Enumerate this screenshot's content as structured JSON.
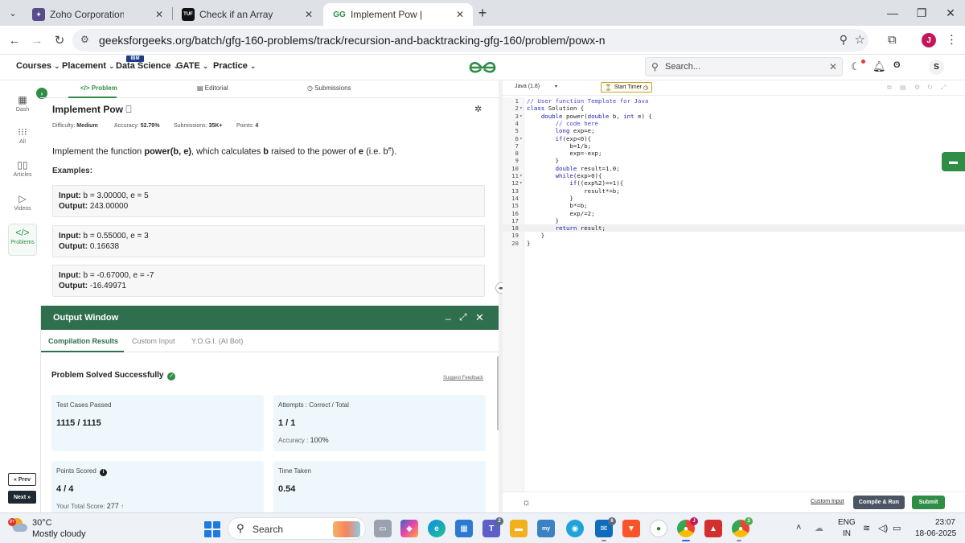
{
  "browser": {
    "tabs": [
      {
        "title": "Zoho Corporation | MTS | Chen",
        "active": false
      },
      {
        "title": "Check if an Array is Sorted - Tu",
        "active": false
      },
      {
        "title": "Implement Pow | Practice | Gee",
        "active": true
      }
    ],
    "url": "geeksforgeeks.org/batch/gfg-160-problems/track/recursion-and-backtracking-gfg-160/problem/powx-n",
    "profile_initial": "J"
  },
  "gfg_header": {
    "menu": [
      "Courses",
      "Placement",
      "Data Science",
      "GATE",
      "Practice"
    ],
    "ibm_badge": "IBM",
    "search_placeholder": "Search...",
    "user_initial": "S",
    "logo_color": "#2f8d46"
  },
  "rail": {
    "items": [
      "Dash",
      "All",
      "Articles",
      "Videos",
      "Problems"
    ],
    "active": "Problems",
    "prev_label": "« Prev",
    "next_label": "Next »"
  },
  "problem": {
    "tabs": [
      "Problem",
      "Editorial",
      "Submissions"
    ],
    "title": "Implement Pow",
    "meta": {
      "difficulty_label": "Difficulty:",
      "difficulty": "Medium",
      "accuracy_label": "Accuracy:",
      "accuracy": "52.79%",
      "submissions_label": "Submissions:",
      "submissions": "35K+",
      "points_label": "Points:",
      "points": "4"
    },
    "statement": {
      "prefix": "Implement the function ",
      "func": "power(b, e)",
      "mid": ", which calculates ",
      "b": "b",
      "mid2": " raised to the power of ",
      "e": "e",
      "suffix_open": " (i.e. b",
      "sup": "e",
      "suffix_close": ")."
    },
    "examples_label": "Examples:",
    "input_label": "Input:",
    "output_label": "Output:",
    "examples": [
      {
        "input": "b = 3.00000, e = 5",
        "output": "243.00000"
      },
      {
        "input": "b = 0.55000, e = 3",
        "output": "0.16638"
      },
      {
        "input": "b = -0.67000, e = -7",
        "output": "-16.49971"
      }
    ]
  },
  "output_window": {
    "title": "Output Window",
    "tabs": [
      "Compilation Results",
      "Custom Input",
      "Y.O.G.I. (AI Bot)"
    ],
    "status": "Problem Solved Successfully",
    "feedback": "Suggest Feedback",
    "cards": {
      "tests_label": "Test Cases Passed",
      "tests_value": "1115 / 1115",
      "attempts_label": "Attempts : Correct / Total",
      "attempts_value": "1 / 1",
      "accuracy_label": "Accuracy :",
      "accuracy_value": "100%",
      "points_label": "Points Scored",
      "points_value": "4 / 4",
      "total_score_label": "Your Total Score:",
      "total_score_value": "277",
      "time_label": "Time Taken",
      "time_value": "0.54"
    }
  },
  "editor": {
    "language": "Java (1.8)",
    "timer_label": "Start Timer",
    "highlighted_line": 18,
    "code": [
      {
        "n": "1",
        "fold": "",
        "t": "// User function Template for Java",
        "cls": "cm"
      },
      {
        "n": "2",
        "fold": "▾",
        "t": "class Solution {",
        "cls": "kwline"
      },
      {
        "n": "3",
        "fold": "▾",
        "t": "    double power(double b, int e) {",
        "cls": "kwline"
      },
      {
        "n": "4",
        "fold": "",
        "t": "        // code here",
        "cls": "cm"
      },
      {
        "n": "5",
        "fold": "",
        "t": "        long exp=e;",
        "cls": "kwline"
      },
      {
        "n": "6",
        "fold": "▾",
        "t": "        if(exp<0){",
        "cls": "kwline"
      },
      {
        "n": "7",
        "fold": "",
        "t": "            b=1/b;",
        "cls": ""
      },
      {
        "n": "8",
        "fold": "",
        "t": "            exp=-exp;",
        "cls": ""
      },
      {
        "n": "9",
        "fold": "",
        "t": "        }",
        "cls": ""
      },
      {
        "n": "10",
        "fold": "",
        "t": "        double result=1.0;",
        "cls": "kwline"
      },
      {
        "n": "11",
        "fold": "▾",
        "t": "        while(exp>0){",
        "cls": "kwline"
      },
      {
        "n": "12",
        "fold": "▾",
        "t": "            if((exp%2)==1){",
        "cls": "kwline"
      },
      {
        "n": "13",
        "fold": "",
        "t": "                result*=b;",
        "cls": ""
      },
      {
        "n": "14",
        "fold": "",
        "t": "            }",
        "cls": ""
      },
      {
        "n": "15",
        "fold": "",
        "t": "            b*=b;",
        "cls": ""
      },
      {
        "n": "16",
        "fold": "",
        "t": "            exp/=2;",
        "cls": ""
      },
      {
        "n": "17",
        "fold": "",
        "t": "        }",
        "cls": ""
      },
      {
        "n": "18",
        "fold": "",
        "t": "        return result;",
        "cls": "kwline"
      },
      {
        "n": "19",
        "fold": "",
        "t": "    }",
        "cls": ""
      },
      {
        "n": "20",
        "fold": "",
        "t": "}",
        "cls": ""
      }
    ],
    "custom_input_label": "Custom Input",
    "compile_label": "Compile & Run",
    "submit_label": "Submit"
  },
  "taskbar": {
    "weather_badge": "9+",
    "temperature": "30°C",
    "weather": "Mostly cloudy",
    "search_label": "Search",
    "badges": {
      "teams": "2",
      "mail": "6",
      "chrome_j": "J",
      "chrome3": "3"
    },
    "lang_top": "ENG",
    "lang_bottom": "IN",
    "time": "23:07",
    "date": "18-06-2025"
  }
}
